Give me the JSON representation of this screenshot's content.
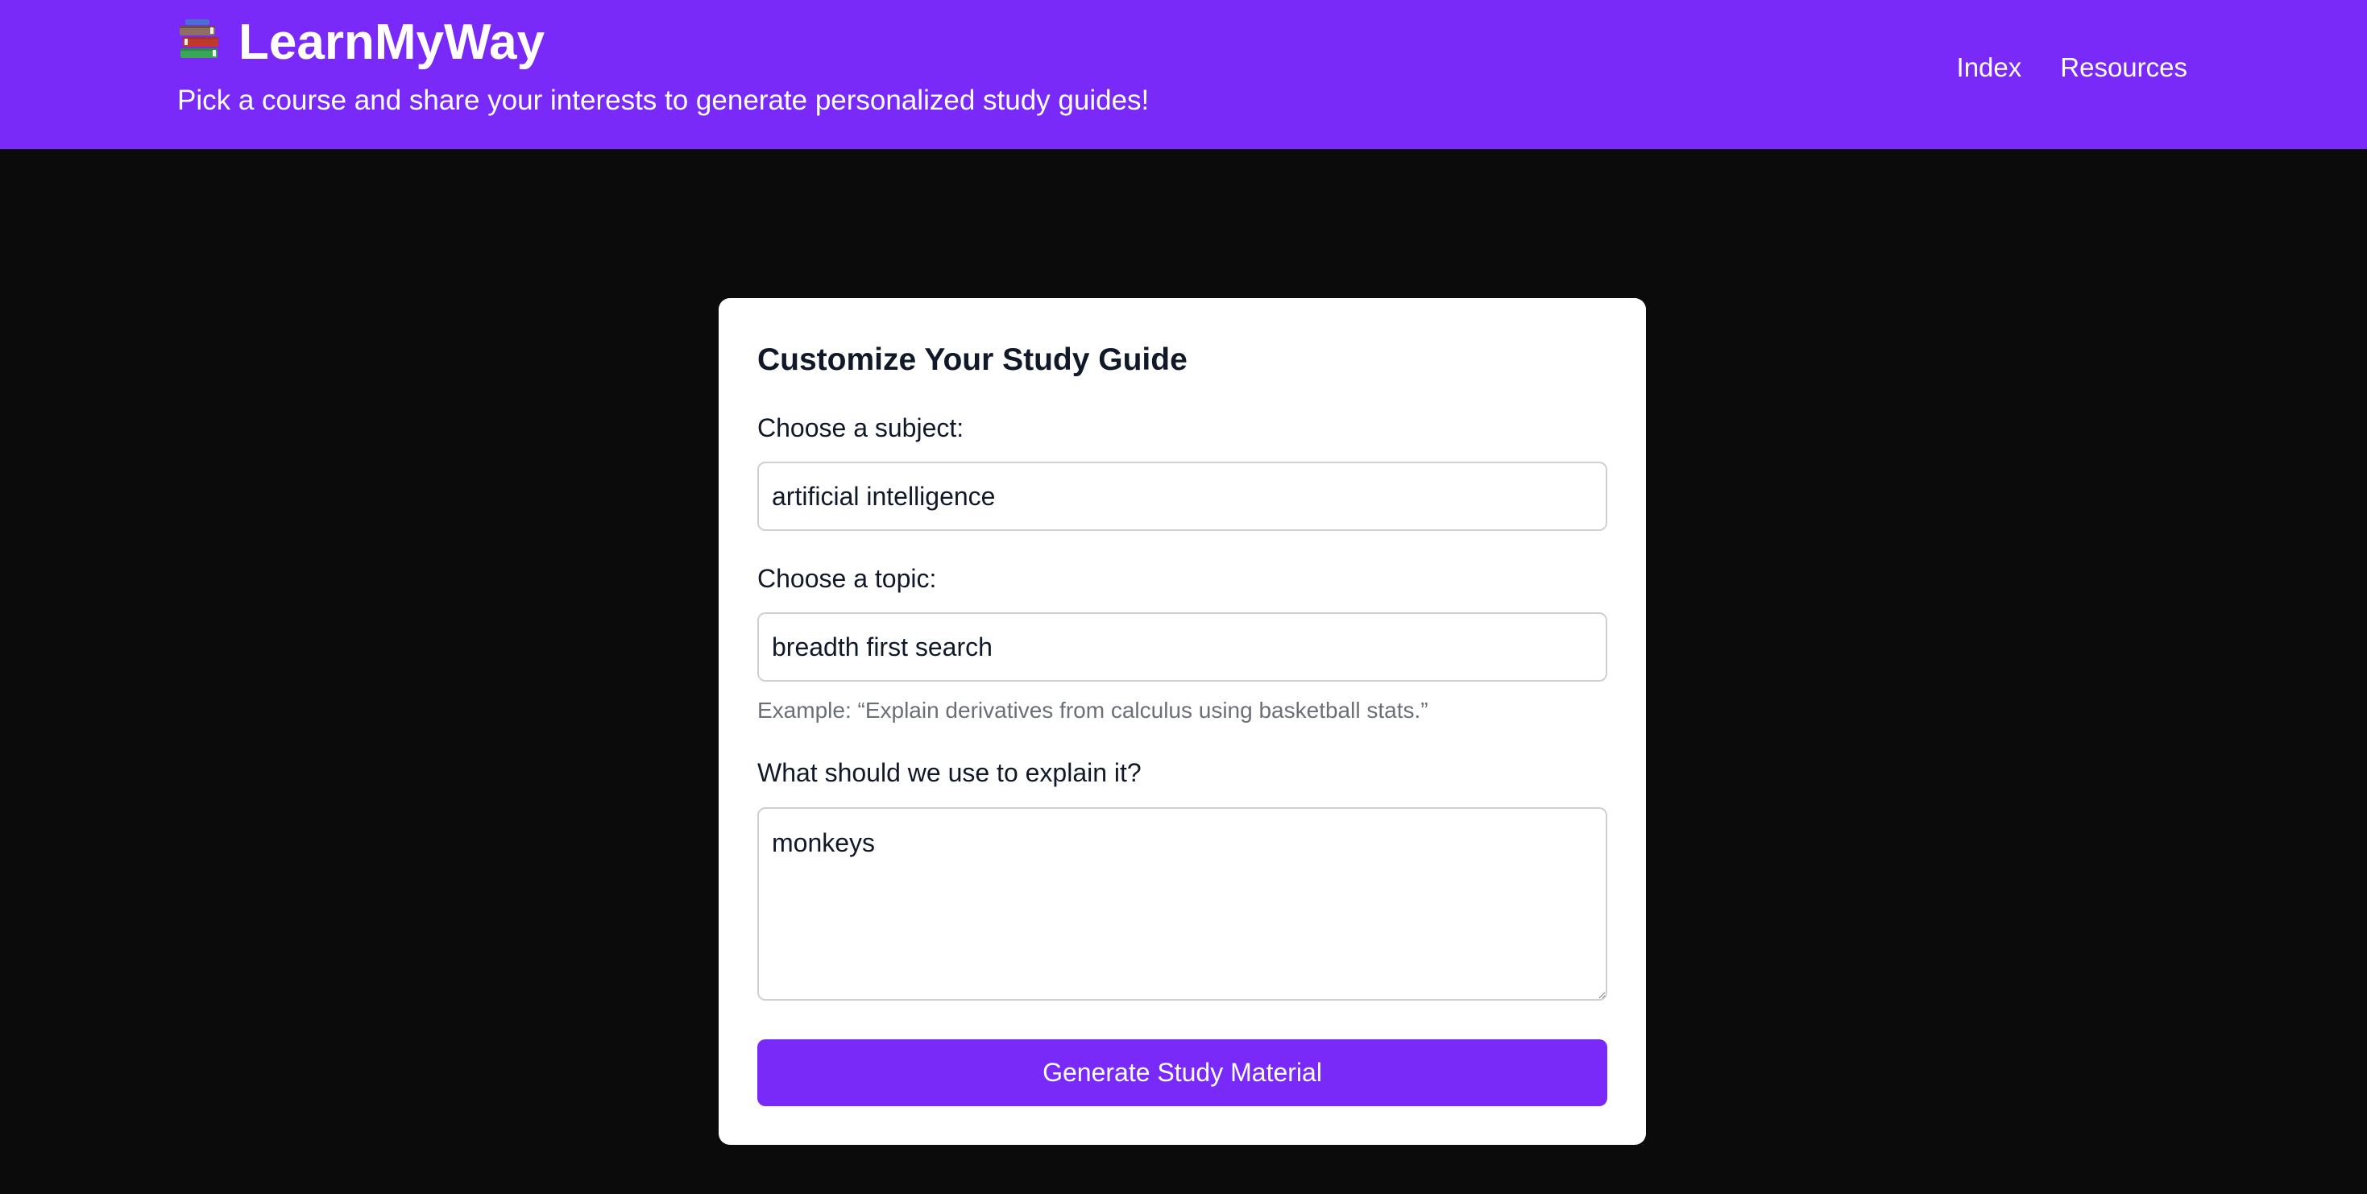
{
  "header": {
    "logo_icon": "books-icon",
    "title": "LearnMyWay",
    "tagline": "Pick a course and share your interests to generate personalized study guides!",
    "nav": [
      {
        "label": "Index"
      },
      {
        "label": "Resources"
      }
    ],
    "brand_color": "#7a2af8"
  },
  "form": {
    "title": "Customize Your Study Guide",
    "subject": {
      "label": "Choose a subject:",
      "value": "artificial intelligence"
    },
    "topic": {
      "label": "Choose a topic:",
      "value": "breadth first search",
      "hint": "Example: “Explain derivatives from calculus using basketball stats.”"
    },
    "explain": {
      "label": "What should we use to explain it?",
      "value": "monkeys"
    },
    "submit_label": "Generate Study Material"
  }
}
